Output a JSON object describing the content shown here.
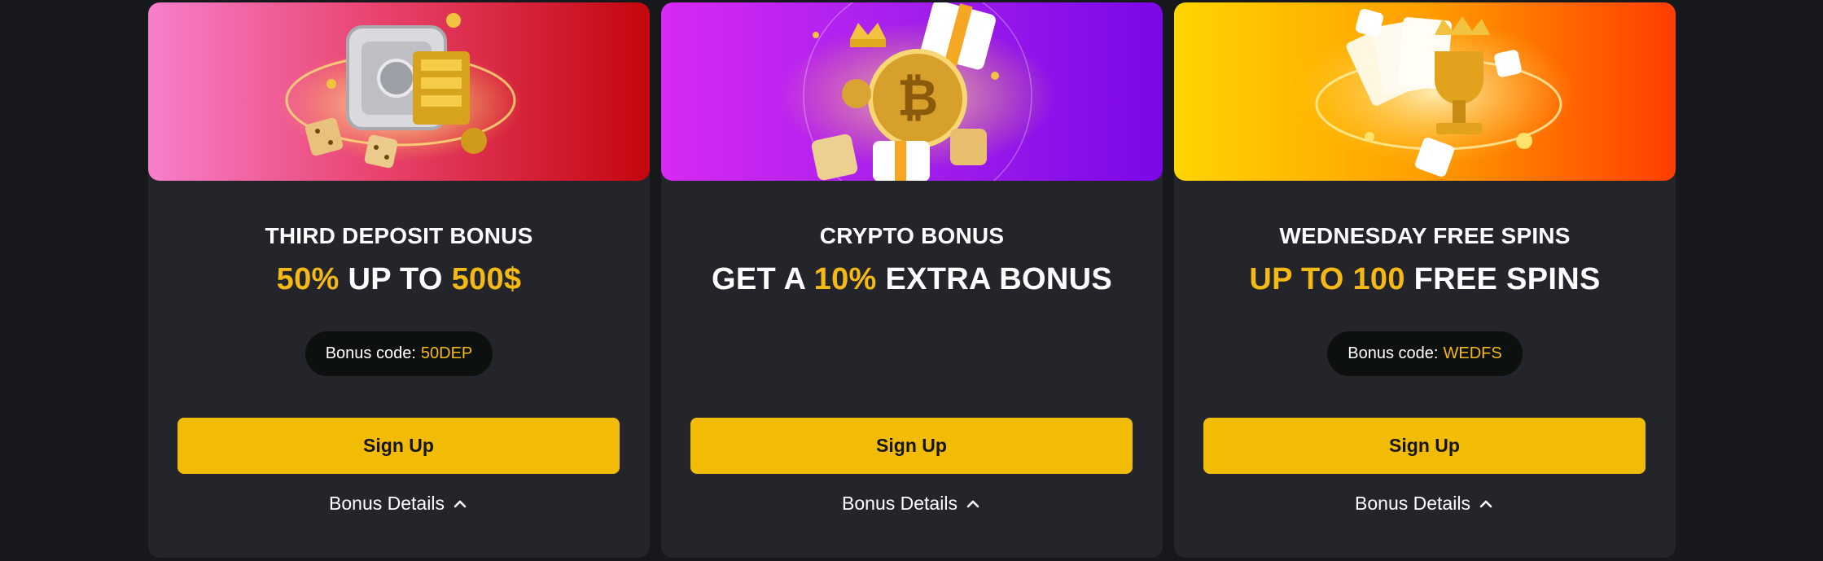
{
  "cards": [
    {
      "title": "THIRD DEPOSIT BONUS",
      "offer": {
        "pre": "",
        "hl1": "50%",
        "mid": " UP TO ",
        "hl2": "500$",
        "post": ""
      },
      "bonus_code_label": "Bonus code:",
      "bonus_code": "50DEP",
      "signup_label": "Sign Up",
      "details_label": "Bonus Details",
      "banner_icon": "gold-safe-dice-illustration"
    },
    {
      "title": "CRYPTO BONUS",
      "offer": {
        "pre": "GET A ",
        "hl1": "10%",
        "mid": " EXTRA BONUS",
        "hl2": "",
        "post": ""
      },
      "bonus_code_label": "",
      "bonus_code": "",
      "signup_label": "Sign Up",
      "details_label": "Bonus Details",
      "banner_icon": "bitcoin-gift-crown-illustration"
    },
    {
      "title": "WEDNESDAY FREE SPINS",
      "offer": {
        "pre": "",
        "hl1": "UP TO 100",
        "mid": " FREE SPINS",
        "hl2": "",
        "post": ""
      },
      "bonus_code_label": "Bonus code:",
      "bonus_code": "WEDFS",
      "signup_label": "Sign Up",
      "details_label": "Bonus Details",
      "banner_icon": "cards-trophy-crown-illustration"
    }
  ],
  "colors": {
    "background": "#17181c",
    "card": "#24252b",
    "accent": "#f4b914",
    "button": "#f2bb05"
  }
}
